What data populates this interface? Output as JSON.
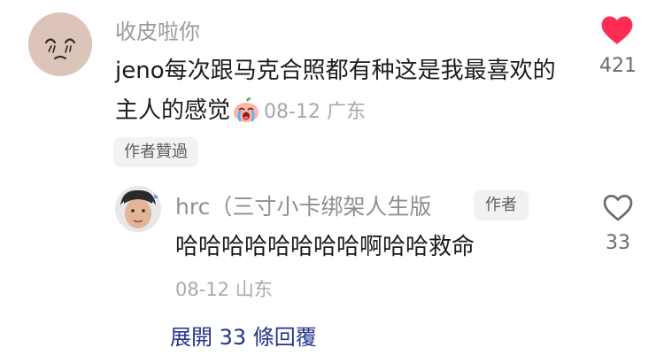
{
  "comment": {
    "username": "收皮啦你",
    "text": "jeno每次跟马克合照都有种这是我最喜欢的主人的感觉",
    "date": "08-12",
    "location": "广东",
    "likes": "421",
    "author_liked_badge": "作者贊過"
  },
  "reply": {
    "username": "hrc（三寸小卡绑架人生版",
    "author_tag": "作者",
    "text": "哈哈哈哈哈哈哈哈啊哈哈救命",
    "date": "08-12",
    "location": "山东",
    "likes": "33"
  },
  "expand_label": "展開 33 條回覆",
  "icons": {
    "like_filled": "heart-filled-icon",
    "like_outline": "heart-outline-icon",
    "emoji": "crying-emoji-icon"
  },
  "colors": {
    "like_red": "#fe2c55",
    "link_blue": "#24348a"
  }
}
